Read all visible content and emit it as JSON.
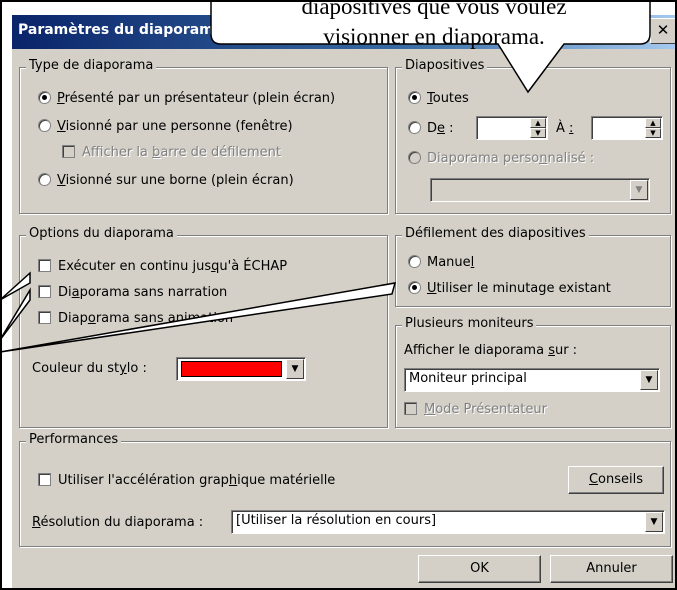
{
  "window": {
    "title": "Paramètres du diaporama",
    "close_glyph": "✕"
  },
  "callout": {
    "line1": "diapositives que vous voulez",
    "line2": "visionner en diaporama."
  },
  "type_diaporama": {
    "legend": "Type de diaporama",
    "options": [
      {
        "pre": "",
        "u": "P",
        "post": "résenté par un présentateur (plein écran)",
        "checked": true
      },
      {
        "pre": "",
        "u": "V",
        "post": "isionné par une personne (fenêtre)",
        "checked": false
      },
      {
        "pre": "",
        "u": "V",
        "post": "isionné sur une borne (plein écran)",
        "checked": false
      }
    ],
    "scrollbar_check": {
      "pre": "Afficher la ",
      "u": "b",
      "post": "arre de défilement",
      "enabled": false
    }
  },
  "diapositives": {
    "legend": "Diapositives",
    "toutes": {
      "u": "T",
      "post": "outes",
      "checked": true
    },
    "de": {
      "pre": "D",
      "u": "e",
      "post": " :",
      "checked": false,
      "value": ""
    },
    "a": {
      "pre": "À ",
      "u": ":",
      "value": ""
    },
    "perso": {
      "pre": "Diaporama perso",
      "u": "n",
      "post": "nalisé :",
      "enabled": false,
      "value": ""
    }
  },
  "options_diaporama": {
    "legend": "Options du diaporama",
    "checks": [
      {
        "pre": "Exécuter en continu jus",
        "u": "q",
        "post": "u'à ÉCHAP",
        "checked": false
      },
      {
        "pre": "Di",
        "u": "a",
        "post": "porama sans narration",
        "checked": false
      },
      {
        "pre": "Diap",
        "u": "o",
        "post": "rama sans ",
        "u2": "a",
        "post2": "nimation",
        "checked": false
      }
    ],
    "pen_color": {
      "pre": "Couleur du st",
      "u": "y",
      "post": "lo :",
      "color": "#ff0000"
    }
  },
  "defilement": {
    "legend": "Défilement des diapositives",
    "options": [
      {
        "pre": "Manue",
        "u": "l",
        "post": "",
        "checked": false
      },
      {
        "pre": "",
        "u": "U",
        "post": "tiliser le minutage existant",
        "checked": true
      }
    ]
  },
  "moniteurs": {
    "legend": "Plusieurs moniteurs",
    "label": {
      "pre": "Afficher le diaporama ",
      "u": "s",
      "post": "ur :"
    },
    "value": "Moniteur principal",
    "presenter": {
      "u": "M",
      "post": "ode Présentateur",
      "enabled": false
    }
  },
  "performances": {
    "legend": "Performances",
    "accel": {
      "pre": "Utiliser l'accélération grap",
      "u": "h",
      "post": "ique matérielle",
      "checked": false
    },
    "conseils": {
      "u": "C",
      "post": "onseils"
    },
    "resolution_label": {
      "u": "R",
      "post": "ésolution du diaporama :"
    },
    "resolution_value": "[Utiliser la résolution en cours]"
  },
  "buttons": {
    "ok": "OK",
    "cancel": "Annuler"
  },
  "icons": {
    "dropdown": "▼",
    "spin_up": "▲",
    "spin_down": "▼"
  }
}
